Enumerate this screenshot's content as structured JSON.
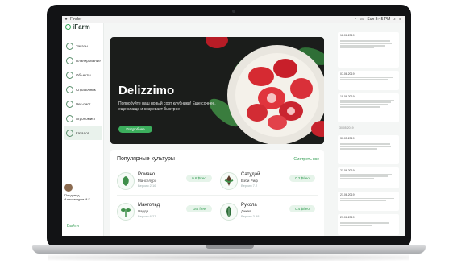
{
  "menubar": {
    "app": "Finder",
    "time": "Sun 3:45 PM"
  },
  "logo": {
    "text": "iFarm"
  },
  "sidebar": {
    "items": [
      {
        "label": "Заказы"
      },
      {
        "label": "Планирование"
      },
      {
        "label": "Объекты"
      },
      {
        "label": "Справочник"
      },
      {
        "label": "Чек-лист"
      },
      {
        "label": "Агрономист"
      },
      {
        "label": "Каталог",
        "active": true
      }
    ],
    "user_line1": "Плодовод",
    "user_line2": "Александров И.К.",
    "logout": "Выйти"
  },
  "hero": {
    "title": "Delizzimo",
    "subtitle": "Попробуйте наш новый сорт клубники! Еще сочнее, еще слаще и созревает быстрее",
    "button": "Подробнее"
  },
  "crops": {
    "title": "Популярные культуры",
    "see_all": "Смотреть все",
    "items": [
      {
        "name": "Романо",
        "sort": "Манселуро",
        "version": "Версия 2.16",
        "price": "0.6 $/гео",
        "icon": "lettuce-icon"
      },
      {
        "name": "Сатудай",
        "sort": "Бэби Риф",
        "version": "Версия 7.2",
        "price": "0.2 $/гео",
        "icon": "arugula-icon"
      },
      {
        "name": "Мангольд",
        "sort": "Чарди",
        "version": "Версия 6.27",
        "price": "Get free",
        "icon": "sprout-icon"
      },
      {
        "name": "Рукола",
        "sort": "Дикая",
        "version": "Версия 3.98",
        "price": "0.4 $/гео",
        "icon": "rucola-icon"
      }
    ]
  },
  "feed": {
    "items": [
      {
        "date": "18.06.2019"
      },
      {
        "date": "07.06.2019"
      },
      {
        "date": "18.06.2019"
      },
      {
        "date": "30.05.2019"
      },
      {
        "date": "21.06.2019"
      },
      {
        "date": "21.06.2019"
      },
      {
        "date": "21.06.2019"
      }
    ],
    "separator_date": "30.05.2019"
  },
  "colors": {
    "accent": "#3cae5d",
    "sidebar_active": "#e9f2ec",
    "hero_bg": "#1b1d1b"
  }
}
